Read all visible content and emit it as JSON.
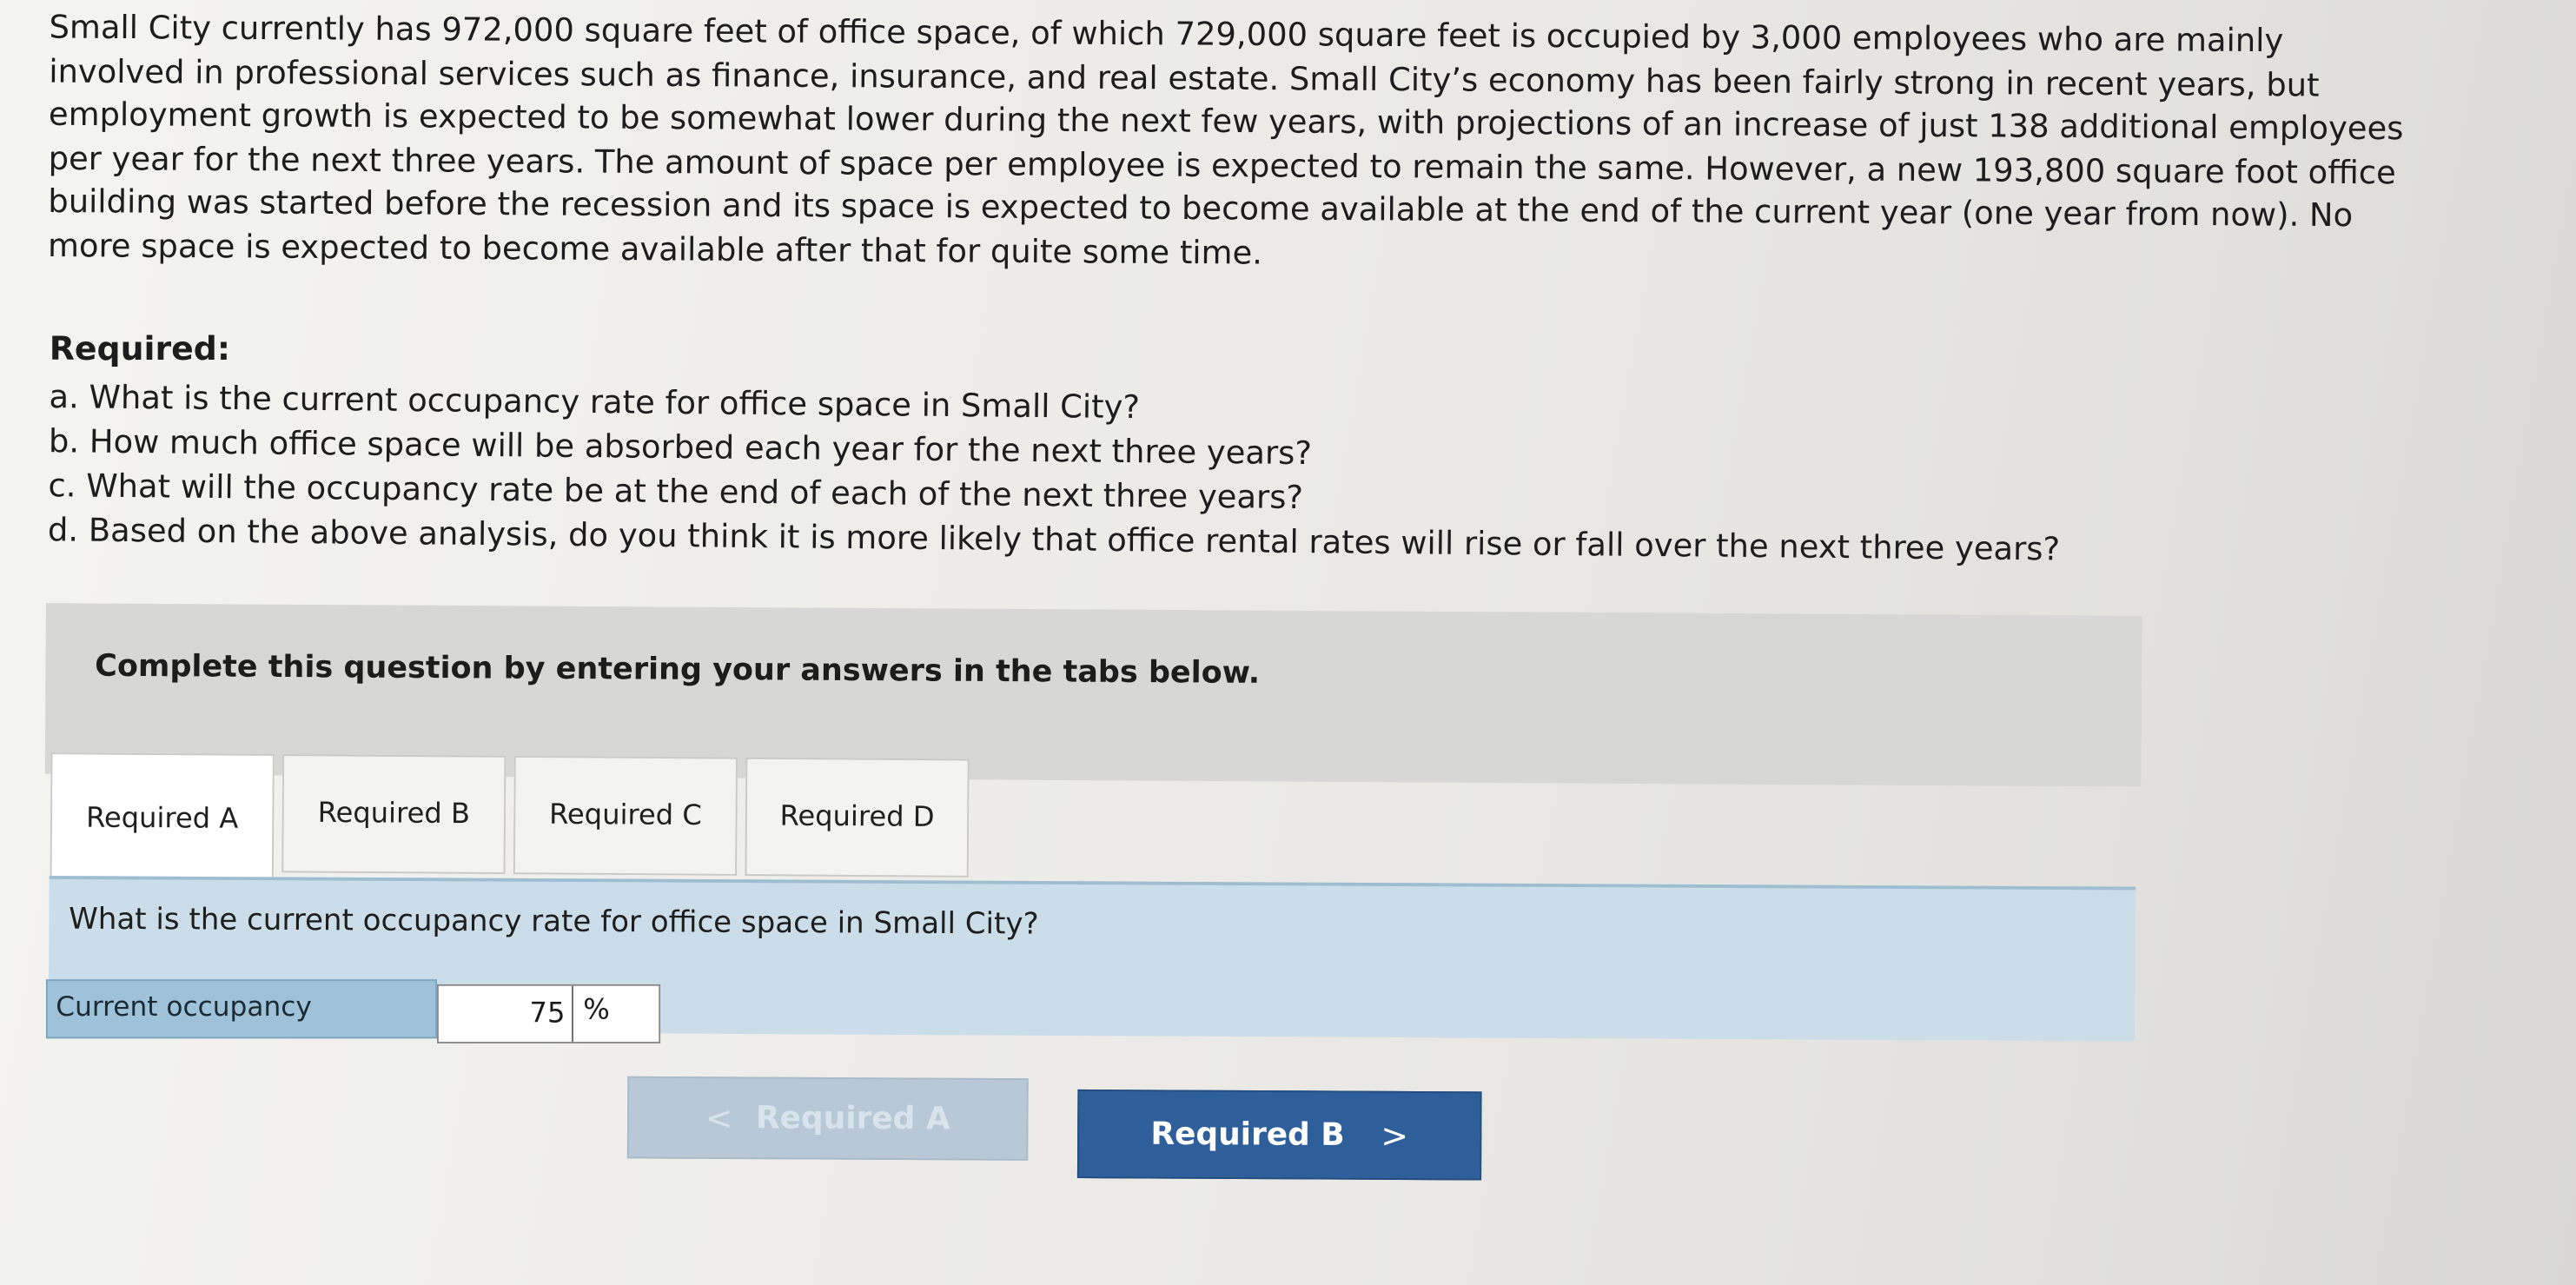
{
  "problem": {
    "paragraph": "Small City currently has 972,000 square feet of office space, of which 729,000 square feet is occupied by 3,000 employees who are mainly involved in professional services such as finance, insurance, and real estate. Small City’s economy has been fairly strong in recent years, but employment growth is expected to be somewhat lower during the next few years, with projections of an increase of just 138 additional employees per year for the next three years. The amount of space per employee is expected to remain the same. However, a new 193,800 square foot office building was started before the recession and its space is expected to become available at the end of the current year (one year from now). No more space is expected to become available after that for quite some time."
  },
  "required": {
    "title": "Required:",
    "questions": [
      "a. What is the current occupancy rate for office space in Small City?",
      "b. How much office space will be absorbed each year for the next three years?",
      "c. What will the occupancy rate be at the end of each of the next three years?",
      "d. Based on the above analysis, do you think it is more likely that office rental rates will rise or fall over the next three years?"
    ]
  },
  "instructions": "Complete this question by entering your answers in the tabs below.",
  "tabs": [
    {
      "label": "Required A",
      "active": true
    },
    {
      "label": "Required B",
      "active": false
    },
    {
      "label": "Required C",
      "active": false
    },
    {
      "label": "Required D",
      "active": false
    }
  ],
  "panel": {
    "question": "What is the current occupancy rate for office space in Small City?",
    "answer_label": "Current occupancy",
    "answer_value": "75",
    "answer_unit": "%"
  },
  "navigation": {
    "prev_label": "Required A",
    "next_label": "Required B",
    "prev_chevron": "<",
    "next_chevron": ">"
  },
  "colors": {
    "panel_blue": "#cbdde8",
    "label_blue": "#9ec2d9",
    "next_button": "#2f5f9b",
    "prev_button_disabled": "#b8c8d6",
    "instructions_gray": "#d7d7d5"
  }
}
